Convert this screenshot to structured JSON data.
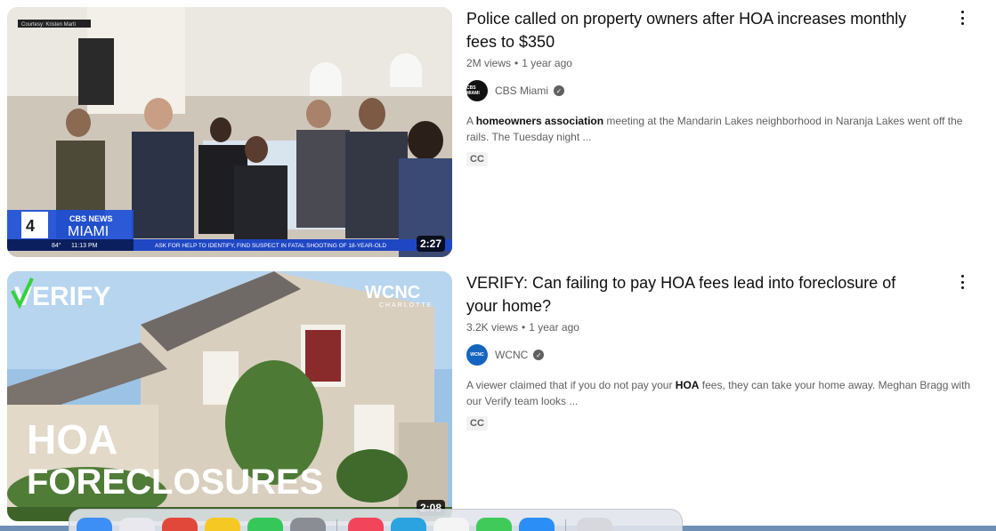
{
  "results": [
    {
      "thumbnail": {
        "credit": "Courtesy: Kristen Marti",
        "network_number": "4",
        "network_name": "CBS NEWS",
        "network_city": "MIAMI",
        "temperature": "84°",
        "time": "11:13 PM",
        "ticker": "ASK FOR HELP TO IDENTIFY, FIND SUSPECT IN FATAL SHOOTING OF 18-YEAR-OLD",
        "duration": "2:27"
      },
      "title": "Police called on property owners after HOA increases monthly fees to $350",
      "views": "2M views",
      "age": "1 year ago",
      "channel": {
        "name": "CBS Miami",
        "avatar_text": "CBS MIAMI",
        "avatar_color": "#111111"
      },
      "description": {
        "pre": "A ",
        "bold": "homeowners association",
        "post": " meeting at the Mandarin Lakes neighborhood in Naranja Lakes went off the rails. The Tuesday night ..."
      },
      "badge": "CC"
    },
    {
      "thumbnail": {
        "brand": "VERIFY",
        "logo": "WCNC",
        "logo_city": "CHARLOTTE",
        "headline_1": "HOA",
        "headline_2": "FORECLOSURES",
        "duration": "2:08"
      },
      "title": "VERIFY: Can failing to pay HOA fees lead into foreclosure of your home?",
      "views": "3.2K views",
      "age": "1 year ago",
      "channel": {
        "name": "WCNC",
        "avatar_text": "WCNC",
        "avatar_color": "#1565c0"
      },
      "description": {
        "pre": "A viewer claimed that if you do not pay your ",
        "bold": "HOA",
        "post": " fees, they can take your home away. Meghan Bragg with our Verify team looks ..."
      },
      "badge": "CC"
    }
  ],
  "dock": {
    "apps": [
      {
        "name": "finder-icon",
        "color": "#3d8ff5"
      },
      {
        "name": "launchpad-icon",
        "color": "#e8e8ee"
      },
      {
        "name": "chrome-icon",
        "color": "#e2483a"
      },
      {
        "name": "notes-icon",
        "color": "#f6c823"
      },
      {
        "name": "messages-icon",
        "color": "#35c759"
      },
      {
        "name": "system-settings-icon",
        "color": "#8a8d94"
      },
      {
        "name": "music-icon",
        "color": "#f2445a"
      },
      {
        "name": "telegram-icon",
        "color": "#2aa3e0"
      },
      {
        "name": "textedit-icon",
        "color": "#f4f4f4"
      },
      {
        "name": "facetime-icon",
        "color": "#3fca5a"
      },
      {
        "name": "safari-icon",
        "color": "#2b8df6"
      },
      {
        "name": "trash-icon",
        "color": "#d6d8de"
      }
    ]
  }
}
